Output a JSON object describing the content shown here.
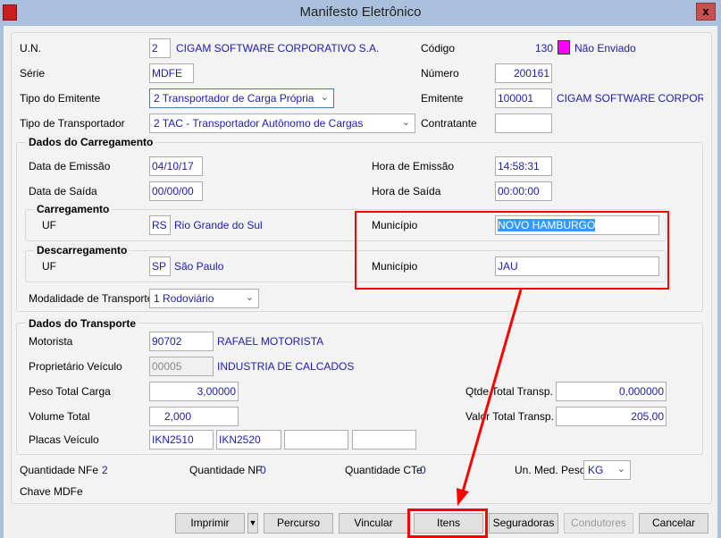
{
  "window": {
    "title": "Manifesto Eletrônico",
    "close": "x"
  },
  "header": {
    "un_label": "U.N.",
    "un_value": "2",
    "un_name": "CIGAM SOFTWARE CORPORATIVO S.A.",
    "codigo_label": "Código",
    "codigo_value": "130",
    "status_color": "#ff00ff",
    "status_text": "Não Enviado",
    "serie_label": "Série",
    "serie_value": "MDFE",
    "numero_label": "Número",
    "numero_value": "200161",
    "tipo_emitente_label": "Tipo do Emitente",
    "tipo_emitente_value": "2 Transportador de Carga Própria",
    "emitente_label": "Emitente",
    "emitente_value": "100001",
    "emitente_name": "CIGAM SOFTWARE CORPORATIVO",
    "tipo_transp_label": "Tipo de Transportador",
    "tipo_transp_value": "2 TAC - Transportador Autônomo de Cargas",
    "contratante_label": "Contratante",
    "contratante_value": ""
  },
  "carregamento": {
    "group": "Dados do Carregamento",
    "data_emissao_label": "Data de Emissão",
    "data_emissao": "04/10/17",
    "hora_emissao_label": "Hora de Emissão",
    "hora_emissao": "14:58:31",
    "data_saida_label": "Data de Saída",
    "data_saida": "00/00/00",
    "hora_saida_label": "Hora de Saída",
    "hora_saida": "00:00:00",
    "carr_group": "Carregamento",
    "carr_uf_label": "UF",
    "carr_uf": "RS",
    "carr_uf_name": "Rio Grande do Sul",
    "carr_mun_label": "Município",
    "carr_mun": "NOVO HAMBURGO",
    "desc_group": "Descarregamento",
    "desc_uf_label": "UF",
    "desc_uf": "SP",
    "desc_uf_name": "São Paulo",
    "desc_mun_label": "Município",
    "desc_mun": "JAU",
    "modalidade_label": "Modalidade de Transporte",
    "modalidade": "1 Rodoviário"
  },
  "transporte": {
    "group": "Dados do Transporte",
    "motorista_label": "Motorista",
    "motorista": "90702",
    "motorista_name": "RAFAEL MOTORISTA",
    "proprietario_label": "Proprietário Veículo",
    "proprietario": "00005",
    "proprietario_name": "INDUSTRIA DE CALCADOS",
    "peso_label": "Peso Total Carga",
    "peso": "3,00000",
    "qtde_label": "Qtde Total Transp.",
    "qtde": "0,000000",
    "volume_label": "Volume Total",
    "volume": "2,000",
    "valor_label": "Valor Total Transp.",
    "valor": "205,00",
    "placas_label": "Placas Veículo",
    "placas": [
      "IKN2510",
      "IKN2520",
      "",
      ""
    ]
  },
  "footer": {
    "qtd_nfe_label": "Quantidade NFe",
    "qtd_nfe": "2",
    "qtd_nf_label": "Quantidade NF",
    "qtd_nf": "0",
    "qtd_cte_label": "Quantidade CTe",
    "qtd_cte": "0",
    "unmed_label": "Un. Med. Peso",
    "unmed": "KG",
    "chave_label": "Chave MDFe"
  },
  "buttons": {
    "imprimir": "Imprimir",
    "percurso": "Percurso",
    "vincular": "Vincular",
    "itens": "Itens",
    "seguradoras": "Seguradoras",
    "condutores": "Condutores",
    "cancelar": "Cancelar"
  },
  "annotation_color": "#ff0000"
}
